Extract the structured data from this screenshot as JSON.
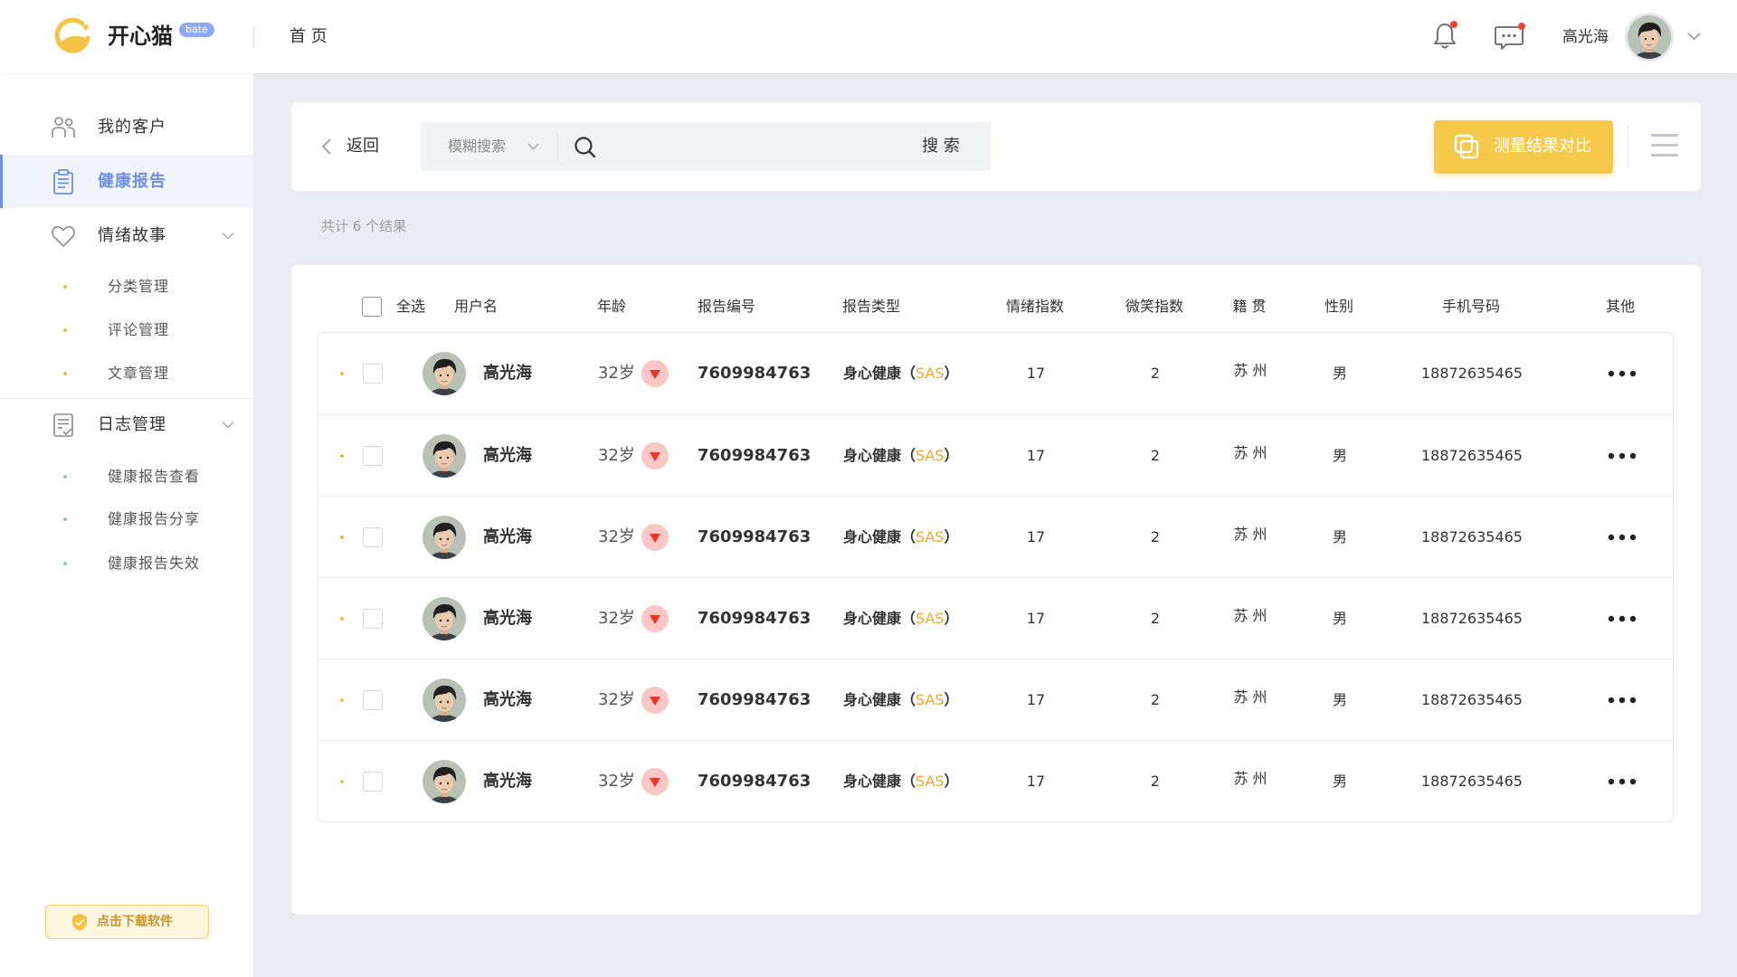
{
  "header": {
    "brand": "开心猫",
    "badge": "bate",
    "nav_home": "首 页",
    "username": "高光海",
    "icons": [
      "cat-logo-icon",
      "bell-icon",
      "chat-icon",
      "chevron-down-icon"
    ]
  },
  "sidebar": {
    "items": [
      {
        "label": "我的客户",
        "icon": "customers-icon"
      },
      {
        "label": "健康报告",
        "icon": "report-icon",
        "active": true
      },
      {
        "label": "情绪故事",
        "icon": "heart-icon",
        "expanded": true,
        "children": [
          "分类管理",
          "评论管理",
          "文章管理"
        ]
      },
      {
        "label": "日志管理",
        "icon": "log-icon",
        "expanded": true,
        "children": [
          "健康报告查看",
          "健康报告分享",
          "健康报告失效"
        ]
      }
    ],
    "download_label": "点击下载软件"
  },
  "toolbar": {
    "back_label": "返回",
    "search_mode": "模糊搜索",
    "search_button": "搜 索",
    "compare_button": "测量结果对比"
  },
  "result_count": "共计 6 个结果",
  "table": {
    "select_all": "全选",
    "columns": [
      "用户名",
      "年龄",
      "报告编号",
      "报告类型",
      "情绪指数",
      "微笑指数",
      "籍 贯",
      "性别",
      "手机号码",
      "其他"
    ],
    "rows": [
      {
        "name": "高光海",
        "age": "32岁",
        "trend": "down",
        "report_no": "7609984763",
        "type_name": "身心健康",
        "type_open": "（",
        "type_code": "SAS",
        "type_close": "）",
        "emotion": "17",
        "smile": "2",
        "native": "苏 州",
        "gender": "男",
        "phone": "18872635465"
      },
      {
        "name": "高光海",
        "age": "32岁",
        "trend": "down",
        "report_no": "7609984763",
        "type_name": "身心健康",
        "type_open": "（",
        "type_code": "SAS",
        "type_close": "）",
        "emotion": "17",
        "smile": "2",
        "native": "苏 州",
        "gender": "男",
        "phone": "18872635465"
      },
      {
        "name": "高光海",
        "age": "32岁",
        "trend": "down",
        "report_no": "7609984763",
        "type_name": "身心健康",
        "type_open": "（",
        "type_code": "SAS",
        "type_close": "）",
        "emotion": "17",
        "smile": "2",
        "native": "苏 州",
        "gender": "男",
        "phone": "18872635465"
      },
      {
        "name": "高光海",
        "age": "32岁",
        "trend": "down",
        "report_no": "7609984763",
        "type_name": "身心健康",
        "type_open": "（",
        "type_code": "SAS",
        "type_close": "）",
        "emotion": "17",
        "smile": "2",
        "native": "苏 州",
        "gender": "男",
        "phone": "18872635465"
      },
      {
        "name": "高光海",
        "age": "32岁",
        "trend": "down",
        "report_no": "7609984763",
        "type_name": "身心健康",
        "type_open": "（",
        "type_code": "SAS",
        "type_close": "）",
        "emotion": "17",
        "smile": "2",
        "native": "苏 州",
        "gender": "男",
        "phone": "18872635465"
      },
      {
        "name": "高光海",
        "age": "32岁",
        "trend": "down",
        "report_no": "7609984763",
        "type_name": "身心健康",
        "type_open": "（",
        "type_code": "SAS",
        "type_close": "）",
        "emotion": "17",
        "smile": "2",
        "native": "苏 州",
        "gender": "男",
        "phone": "18872635465"
      }
    ]
  },
  "colors": {
    "accent_blue": "#6d8fe6",
    "brand_yellow": "#f6c94b",
    "type_code_orange": "#f5a623",
    "trend_red": "#e8342b",
    "notification_red": "#f0433a",
    "page_bg": "#ebecf3",
    "emotion_sub_dot": "#f5c046",
    "log_sub_dot": "#8cc9b3"
  }
}
